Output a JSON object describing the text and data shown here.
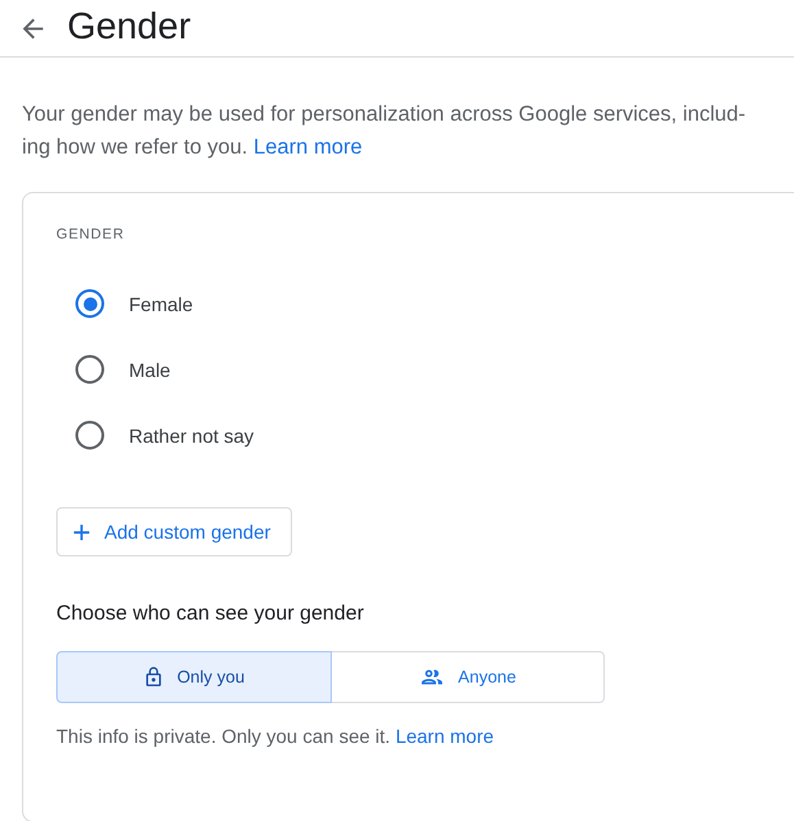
{
  "header": {
    "title": "Gender"
  },
  "intro": {
    "text": "Your gender may be used for personalization across Google services, includ-\ning how we refer to you.",
    "link": "Learn more"
  },
  "card": {
    "label": "GENDER",
    "options": [
      {
        "label": "Female",
        "selected": true
      },
      {
        "label": "Male",
        "selected": false
      },
      {
        "label": "Rather not say",
        "selected": false
      }
    ],
    "add_button": {
      "label": "Add custom gender"
    },
    "visibility": {
      "heading": "Choose who can see your gender",
      "choices": [
        {
          "label": "Only you",
          "kind": "lock",
          "selected": true
        },
        {
          "label": "Anyone",
          "kind": "people",
          "selected": false
        }
      ],
      "note": "This info is private. Only you can see it.",
      "link": "Learn more"
    }
  }
}
